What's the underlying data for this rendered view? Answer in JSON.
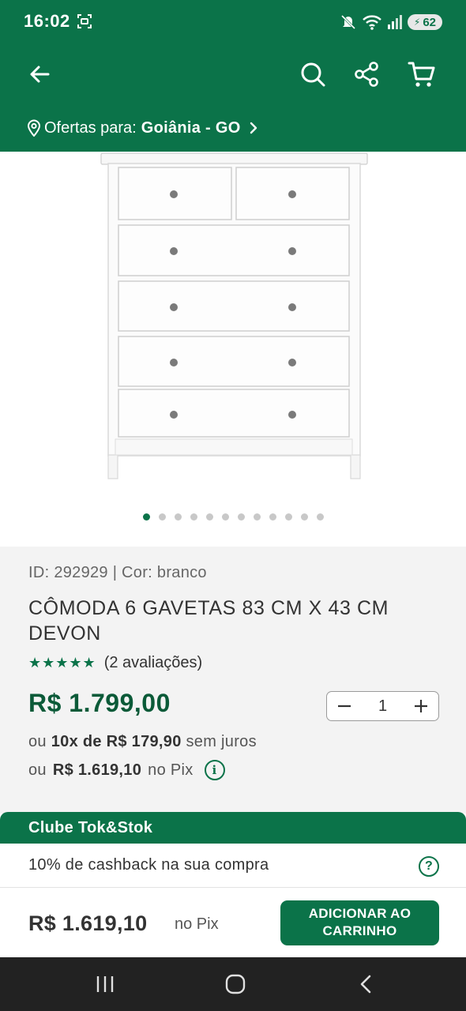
{
  "status_bar": {
    "time": "16:02",
    "battery": "62",
    "icons": [
      "screen-record-icon",
      "mute-icon",
      "wifi-icon",
      "signal-icon",
      "battery-icon"
    ]
  },
  "app_bar": {
    "icons": [
      "back-arrow-icon",
      "search-icon",
      "share-icon",
      "cart-icon"
    ]
  },
  "location": {
    "prefix": "Ofertas para:",
    "city": "Goiânia - GO"
  },
  "gallery": {
    "total_images": 12,
    "active_index": 0
  },
  "product": {
    "id_line": "ID: 292929 | Cor: branco",
    "title": "CÔMODA 6 GAVETAS 83 CM X 43 CM DEVON",
    "stars": "★★★★★",
    "reviews": "(2 avaliações)",
    "price": "R$ 1.799,00",
    "quantity": "1",
    "installments_prefix": "ou",
    "installments_value": "10x de R$ 179,90",
    "installments_suffix": "sem juros",
    "pix_prefix": "ou",
    "pix_value": "R$ 1.619,10",
    "pix_suffix": "no Pix",
    "info_icon": "i"
  },
  "club": {
    "title": "Clube Tok&Stok",
    "cashback": "10% de cashback na sua compra",
    "help_icon": "?"
  },
  "buy_bar": {
    "price": "R$ 1.619,10",
    "pix_label": "no Pix",
    "add_line1": "ADICIONAR AO",
    "add_line2": "CARRINHO"
  },
  "colors": {
    "brand_green": "#0b7349",
    "price_green": "#0b5a38"
  }
}
